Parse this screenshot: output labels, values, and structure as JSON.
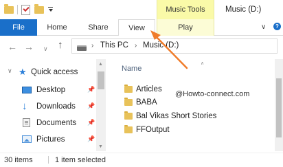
{
  "window": {
    "title": "Music (D:)"
  },
  "contextual_header": {
    "label": "Music Tools"
  },
  "ribbon": {
    "tabs": [
      "File",
      "Home",
      "Share",
      "View",
      "Play"
    ],
    "active_tab": "File",
    "highlighted_tab": "View"
  },
  "address": {
    "crumbs": [
      "This PC",
      "Music (D:)"
    ]
  },
  "navpane": {
    "quick_access_label": "Quick access",
    "items": [
      {
        "label": "Desktop",
        "icon": "desktop-icon"
      },
      {
        "label": "Downloads",
        "icon": "downloads-icon"
      },
      {
        "label": "Documents",
        "icon": "documents-icon"
      },
      {
        "label": "Pictures",
        "icon": "pictures-icon"
      }
    ]
  },
  "content": {
    "column_header": "Name",
    "files": [
      {
        "name": "Articles",
        "icon": "folder-icon"
      },
      {
        "name": "BABA",
        "icon": "folder-icon"
      },
      {
        "name": "Bal Vikas Short Stories",
        "icon": "folder-icon"
      },
      {
        "name": "FFOutput",
        "icon": "folder-icon"
      }
    ],
    "watermark": "@Howto-connect.com"
  },
  "status": {
    "item_count": "30 items",
    "selection": "1 item selected"
  },
  "colors": {
    "file_tab": "#1a6fc9",
    "music_tools": "#fafaa8",
    "annotation_arrow": "#f07c2a",
    "folder": "#e8c25a"
  }
}
